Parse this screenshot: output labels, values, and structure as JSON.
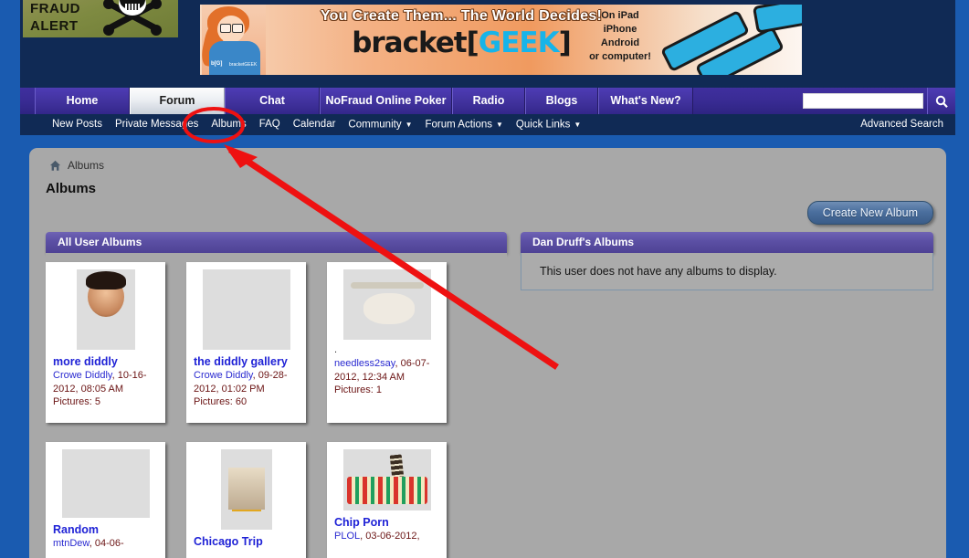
{
  "site": {
    "logo_line1": "FRAUD",
    "logo_line2": "ALERT",
    "logo_icon": "skull-and-crossbones-icon"
  },
  "banner": {
    "headline": "You Create Them... The World Decides!",
    "brand_left": "bracket[",
    "brand_mid": "GEEK",
    "brand_right": "]",
    "platform_lines": "On iPad\niPhone\nAndroid\nor computer!",
    "platform_1": "On iPad",
    "platform_2": "iPhone",
    "platform_3": "Android",
    "platform_4": "or computer!",
    "badge_small": "b[G]",
    "badge_text": "bracketGEEK"
  },
  "nav": {
    "tabs": [
      {
        "label": "Home",
        "active": false
      },
      {
        "label": "Forum",
        "active": true
      },
      {
        "label": "Chat",
        "active": false
      },
      {
        "label": "NoFraud Online Poker",
        "active": false
      },
      {
        "label": "Radio",
        "active": false
      },
      {
        "label": "Blogs",
        "active": false
      },
      {
        "label": "What's New?",
        "active": false
      }
    ],
    "search_value": "",
    "search_placeholder": "",
    "search_icon": "magnifier-icon"
  },
  "subnav": {
    "items": [
      {
        "label": "New Posts",
        "caret": false
      },
      {
        "label": "Private Messages",
        "caret": false
      },
      {
        "label": "Albums",
        "caret": false,
        "highlighted": true
      },
      {
        "label": "FAQ",
        "caret": false
      },
      {
        "label": "Calendar",
        "caret": false
      },
      {
        "label": "Community",
        "caret": true
      },
      {
        "label": "Forum Actions",
        "caret": true
      },
      {
        "label": "Quick Links",
        "caret": true
      }
    ],
    "advanced_search": "Advanced Search"
  },
  "page": {
    "breadcrumb_home_icon": "home-icon",
    "breadcrumb": "Albums",
    "title": "Albums",
    "create_button": "Create New Album"
  },
  "all_user_albums": {
    "heading": "All User Albums",
    "albums": [
      {
        "title": "more diddly",
        "author": "Crowe Diddly",
        "date": "10-16-2012, 08:05 AM",
        "meta": "Crowe Diddly, 10-16-2012, 08:05 AM",
        "pictures": "Pictures: 5",
        "thumb": "portrait-photo-thumbnail"
      },
      {
        "title": "the diddly gallery",
        "author": "Crowe Diddly",
        "date": "09-28-2012, 01:02 PM",
        "meta": "Crowe Diddly, 09-28-2012, 01:02 PM",
        "pictures": "Pictures: 60",
        "thumb": "building-facade-thumbnail"
      },
      {
        "title": ".",
        "author": "needless2say",
        "date": "06-07-2012, 12:34 AM",
        "meta": "needless2say, 06-07-2012, 12:34 AM",
        "pictures": "Pictures: 1",
        "thumb": "longhorn-cow-thumbnail"
      },
      {
        "title": "Random",
        "author": "mtnDew",
        "date": "04-06-",
        "meta": "mtnDew, 04-06-",
        "pictures": "",
        "thumb": "fanned-banknotes-thumbnail"
      },
      {
        "title": "Chicago Trip",
        "author": "",
        "date": "",
        "meta": "",
        "pictures": "",
        "thumb": "chicago-theatre-thumbnail"
      },
      {
        "title": "Chip Porn",
        "author": "PLOL",
        "date": "03-06-2012,",
        "meta": "PLOL, 03-06-2012,",
        "pictures": "",
        "thumb": "poker-chips-thumbnail"
      }
    ]
  },
  "user_albums": {
    "heading": "Dan Druff's Albums",
    "empty_message": "This user does not have any albums to display."
  },
  "annotation": {
    "type": "red-ellipse-and-arrow",
    "color": "#ee1111",
    "target": "Albums sub-navigation link"
  },
  "colors": {
    "page_blue": "#1a5bb0",
    "header_navy": "#102a55",
    "nav_purple": "#3a2c95",
    "content_gray": "#a8a8a8",
    "block_header_purple": "#5b4fa4",
    "link_blue": "#1f22d6",
    "date_maroon": "#6b1414",
    "annotation_red": "#ee1111"
  }
}
